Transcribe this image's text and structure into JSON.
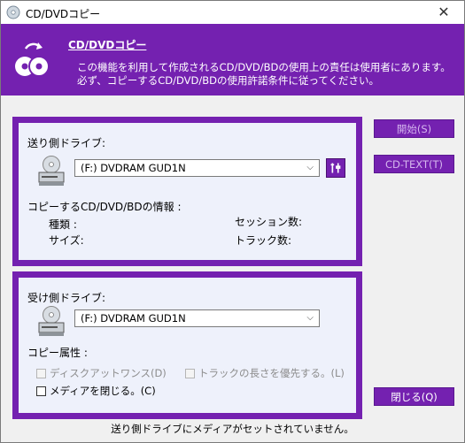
{
  "window": {
    "title": "CD/DVDコピー",
    "close_glyph": "✕"
  },
  "header": {
    "title": "CD/DVDコピー",
    "line1": "この機能を利用して作成されるCD/DVD/BDの使用上の責任は使用者にあります。",
    "line2": "必ず、コピーするCD/DVD/BDの使用許諾条件に従ってください。",
    "icon": "disc-copy-icon"
  },
  "source": {
    "label": "送り側ドライブ:",
    "drive_value": "(F:) DVDRAM GUD1N",
    "settings_icon": "settings-icon",
    "info_label": "コピーするCD/DVD/BDの情報 :",
    "type_label": "種類 :",
    "size_label": "サイズ:",
    "session_label": "セッション数:",
    "track_label": "トラック数:"
  },
  "dest": {
    "label": "受け側ドライブ:",
    "drive_value": "(F:) DVDRAM GUD1N",
    "attr_label": "コピー属性 :",
    "opt_dao": "ディスクアットワンス(D)",
    "opt_track_priority": "トラックの長さを優先する。(L)",
    "opt_close_media": "メディアを閉じる。(C)"
  },
  "buttons": {
    "start": "開始(S)",
    "cd_text": "CD-TEXT(T)",
    "close": "閉じる(Q)"
  },
  "status": "送り側ドライブにメディアがセットされていません。",
  "colors": {
    "accent": "#7421b0",
    "panel_bg": "#eef1fb"
  }
}
